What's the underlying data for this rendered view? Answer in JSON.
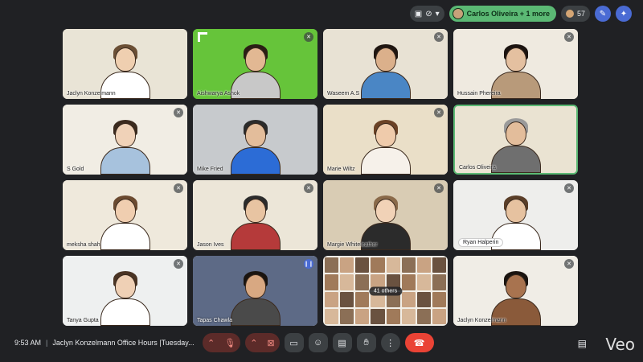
{
  "topbar": {
    "hand_label": "Carlos Oliveira + 1 more",
    "participant_count": "57",
    "icons": [
      "present-icon",
      "captions-off-icon",
      "chevron-down-icon",
      "people-icon",
      "pen-icon",
      "sparkle-icon"
    ]
  },
  "tiles": [
    {
      "name": "Jaclyn Konzelmann",
      "skin": "#efcfb0",
      "hair": "#6b4f35",
      "shirt": "#ffffff",
      "bg": "#e9e4d6",
      "muted": false
    },
    {
      "name": "Aishwarya Ashok",
      "skin": "#e2b893",
      "hair": "#2b1e15",
      "shirt": "#c8c8c8",
      "bg": "#66c43a",
      "muted": true,
      "green": true
    },
    {
      "name": "Waseem A.S",
      "skin": "#dbb08b",
      "hair": "#1f1611",
      "shirt": "#4a86c5",
      "bg": "#e8e2d4",
      "muted": true
    },
    {
      "name": "Hussain Phereira",
      "skin": "#e4c0a0",
      "hair": "#1c1410",
      "shirt": "#b89a7a",
      "bg": "#efeae0",
      "muted": true
    },
    {
      "name": "S Gold",
      "skin": "#f0d2b8",
      "hair": "#3b2a1e",
      "shirt": "#a7c2dd",
      "bg": "#f1ede4",
      "muted": true
    },
    {
      "name": "Mike Fried",
      "skin": "#e3bd9b",
      "hair": "#2b2b2b",
      "shirt": "#2c6cd6",
      "bg": "#c7cacd",
      "muted": false
    },
    {
      "name": "Marie Wiltz",
      "skin": "#efcbab",
      "hair": "#6b4226",
      "shirt": "#f6f1ea",
      "bg": "#eadfc8",
      "muted": true
    },
    {
      "name": "Carlos Oliveira",
      "skin": "#e3bd9b",
      "hair": "#9a9a9a",
      "shirt": "#6f6f6f",
      "bg": "#eae3d2",
      "muted": false,
      "active": true
    },
    {
      "name": "meksha shah",
      "skin": "#f0ceb0",
      "hair": "#6b4a30",
      "shirt": "#ffffff",
      "bg": "#efe9dc",
      "muted": true
    },
    {
      "name": "Jason Ives",
      "skin": "#e8c4a2",
      "hair": "#2b2b2b",
      "shirt": "#b53a3a",
      "bg": "#ece6d8",
      "muted": true
    },
    {
      "name": "Margie Whiteleather",
      "skin": "#f1d2b7",
      "hair": "#8a6a4a",
      "shirt": "#2b2b2b",
      "bg": "#d9ccb4",
      "muted": true
    },
    {
      "name": "Ryan Halperin",
      "skin": "#e6c2a0",
      "hair": "#5a3e28",
      "shirt": "#ffffff",
      "bg": "#eeeeec",
      "muted": true,
      "pill": true
    },
    {
      "name": "Tanya Gupta",
      "skin": "#efd0b5",
      "hair": "#4a3424",
      "shirt": "#ffffff",
      "bg": "#eef0f0",
      "muted": true
    },
    {
      "name": "Tapas Chawla",
      "skin": "#d8a882",
      "hair": "#1a1410",
      "shirt": "#4a4a4a",
      "bg": "#5d6a86",
      "muted": false,
      "speaking": true,
      "darkname": true
    },
    {
      "name": "",
      "others": true,
      "others_label": "41 others"
    },
    {
      "name": "Jaclyn Konzelmann",
      "skin": "#a8734f",
      "hair": "#1a1410",
      "shirt": "#8a5a3a",
      "bg": "#f0ede6",
      "muted": true
    }
  ],
  "bottombar": {
    "time": "9:53 AM",
    "separator": "|",
    "meeting_title": "Jaclyn Konzelmann Office Hours |Tuesday...",
    "watermark": "Veo"
  },
  "colors": {
    "background": "#202124",
    "control": "#3c4043",
    "end_call": "#ea4335",
    "active_border": "#5bb974",
    "muted_control": "#5c2b29"
  }
}
